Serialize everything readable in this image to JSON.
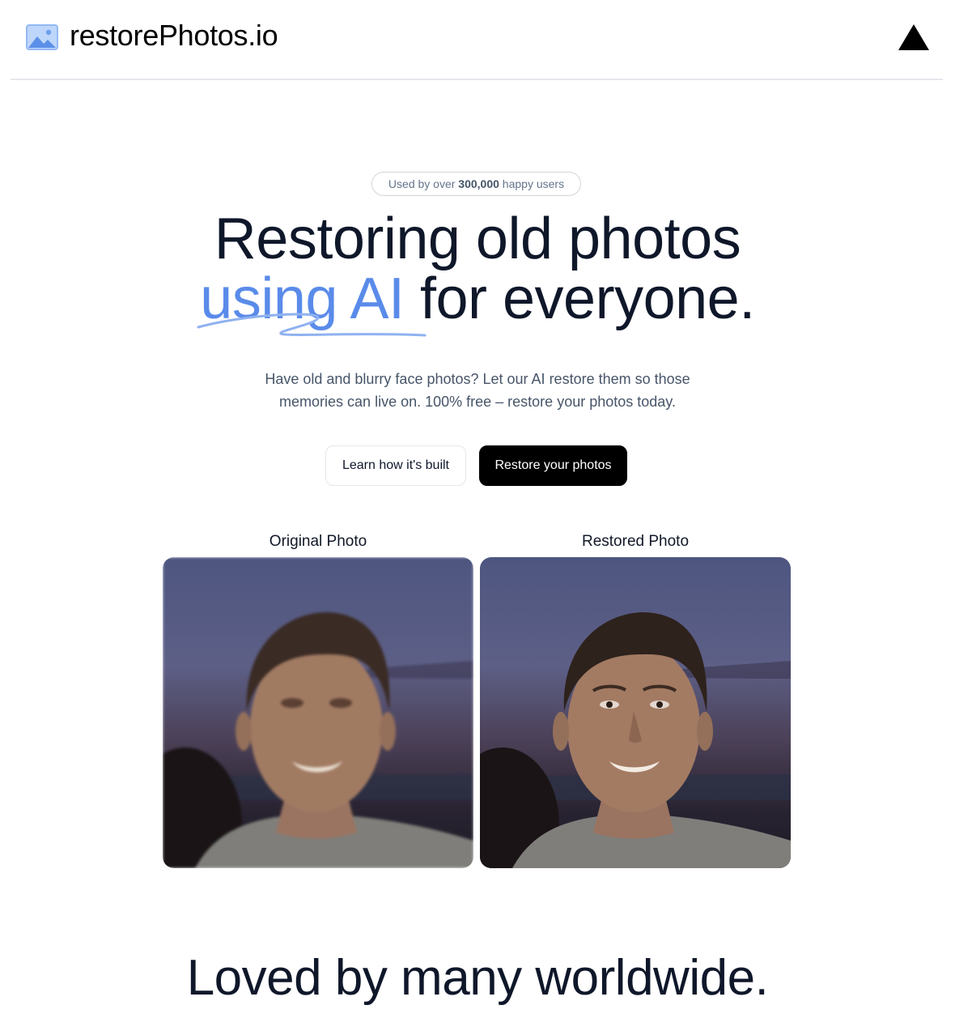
{
  "header": {
    "brand": "restorePhotos.io",
    "brand_icon": "image-icon",
    "vercel_icon": "vercel-logo-icon"
  },
  "hero": {
    "badge_prefix": "Used by over ",
    "badge_count": "300,000",
    "badge_suffix": " happy users",
    "headline_line1": "Restoring old photos",
    "headline_accent": "using AI",
    "headline_rest": " for everyone.",
    "subtext": "Have old and blurry face photos? Let our AI restore them so those memories can live on. 100% free – restore your photos today.",
    "secondary_button": "Learn how it's built",
    "primary_button": "Restore your photos",
    "accent_color": "#5a8bea"
  },
  "comparison": {
    "original_label": "Original Photo",
    "restored_label": "Restored Photo"
  },
  "testimonials": {
    "title": "Loved by many worldwide."
  }
}
